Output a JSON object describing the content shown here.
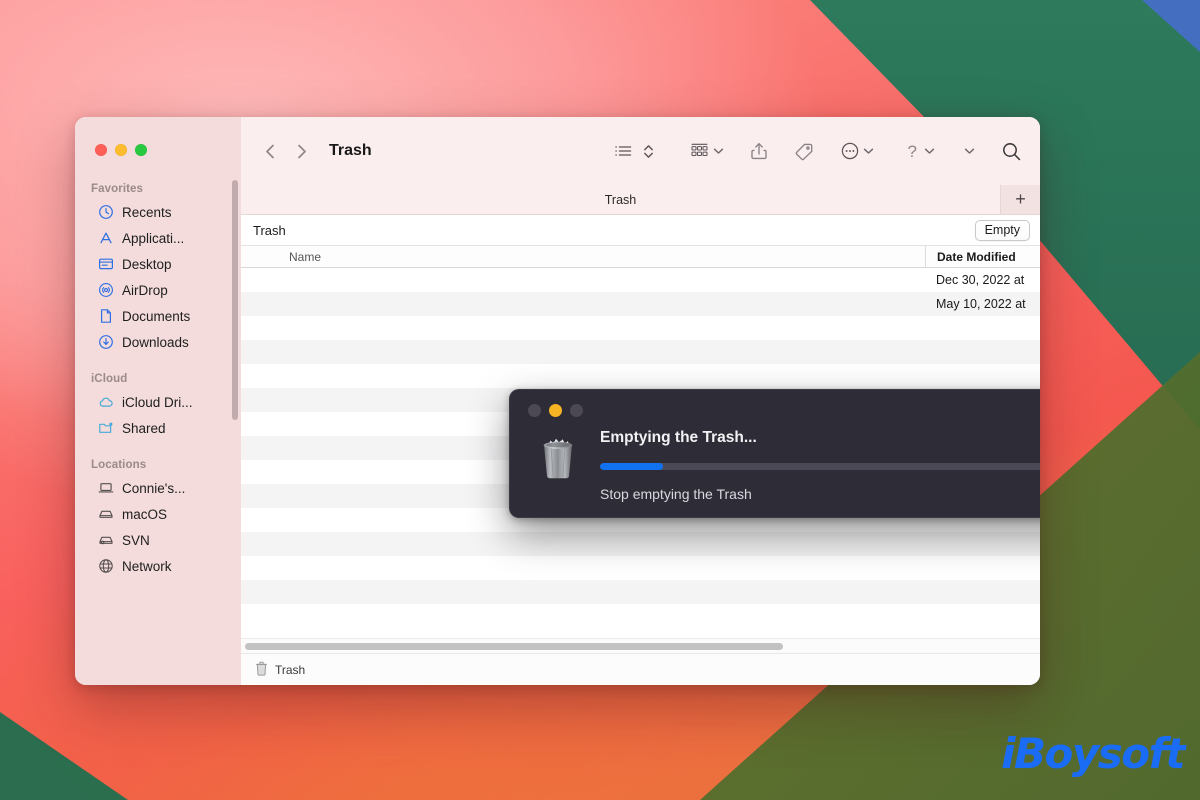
{
  "window": {
    "title": "Trash",
    "traffic_lights": [
      "close",
      "minimize",
      "maximize"
    ]
  },
  "toolbar": {
    "back_icon": "chevron-left-icon",
    "forward_icon": "chevron-right-icon",
    "view_list_icon": "list-view-icon",
    "sort_icon": "sort-updown-icon",
    "group_icon": "group-by-icon",
    "share_icon": "share-icon",
    "tag_icon": "tag-icon",
    "more_icon": "more-ellipsis-icon",
    "help_icon": "help-question-icon",
    "search_icon": "search-icon"
  },
  "tab_bar": {
    "tabs": [
      {
        "label": "Trash",
        "active": true
      }
    ],
    "add_label": "+"
  },
  "trash_header": {
    "label": "Trash",
    "empty_button": "Empty"
  },
  "columns": {
    "name": "Name",
    "date_modified": "Date Modified"
  },
  "files": [
    {
      "name": "",
      "date": "Dec 30, 2022 at"
    },
    {
      "name": "",
      "date": "May 10, 2022 at"
    },
    {
      "name": "",
      "date": ""
    },
    {
      "name": "",
      "date": ""
    },
    {
      "name": "",
      "date": ""
    },
    {
      "name": "",
      "date": ""
    },
    {
      "name": "",
      "date": ""
    },
    {
      "name": "",
      "date": ""
    },
    {
      "name": "",
      "date": ""
    },
    {
      "name": "",
      "date": ""
    },
    {
      "name": "",
      "date": ""
    },
    {
      "name": "",
      "date": ""
    },
    {
      "name": "",
      "date": ""
    },
    {
      "name": "",
      "date": ""
    },
    {
      "name": "",
      "date": ""
    }
  ],
  "status_bar": {
    "label": "Trash",
    "icon": "trash-icon"
  },
  "sidebar": {
    "groups": [
      {
        "title": "Favorites",
        "items": [
          {
            "label": "Recents",
            "icon": "clock-icon"
          },
          {
            "label": "Applicati...",
            "icon": "app-store-icon"
          },
          {
            "label": "Desktop",
            "icon": "desktop-icon"
          },
          {
            "label": "AirDrop",
            "icon": "airdrop-icon"
          },
          {
            "label": "Documents",
            "icon": "document-icon"
          },
          {
            "label": "Downloads",
            "icon": "download-icon"
          }
        ]
      },
      {
        "title": "iCloud",
        "items": [
          {
            "label": "iCloud Dri...",
            "icon": "cloud-icon"
          },
          {
            "label": "Shared",
            "icon": "shared-folder-icon"
          }
        ]
      },
      {
        "title": "Locations",
        "items": [
          {
            "label": "Connie's...",
            "icon": "laptop-icon"
          },
          {
            "label": "macOS",
            "icon": "harddisk-icon"
          },
          {
            "label": "SVN",
            "icon": "external-disk-icon"
          },
          {
            "label": "Network",
            "icon": "globe-icon"
          }
        ]
      }
    ]
  },
  "dialog": {
    "title": "Emptying the Trash...",
    "subtitle": "Stop emptying the Trash",
    "progress_percent": 13,
    "cancel_icon": "close-circle-icon",
    "trash_icon": "trash-full-icon",
    "traffic_lights": [
      "close",
      "minimize",
      "maximize"
    ],
    "active_light": "minimize"
  },
  "watermark": {
    "text": "iBoysoft"
  },
  "colors": {
    "accent_blue": "#1171f0",
    "dialog_bg": "#2e2c36",
    "sidebar_bg": "#f3dcdb",
    "toolbar_bg": "#fbeeee",
    "watermark_blue": "#1a6cf5",
    "traffic_red": "#ff5f57",
    "traffic_yellow": "#febc2e",
    "traffic_green": "#28c840"
  }
}
